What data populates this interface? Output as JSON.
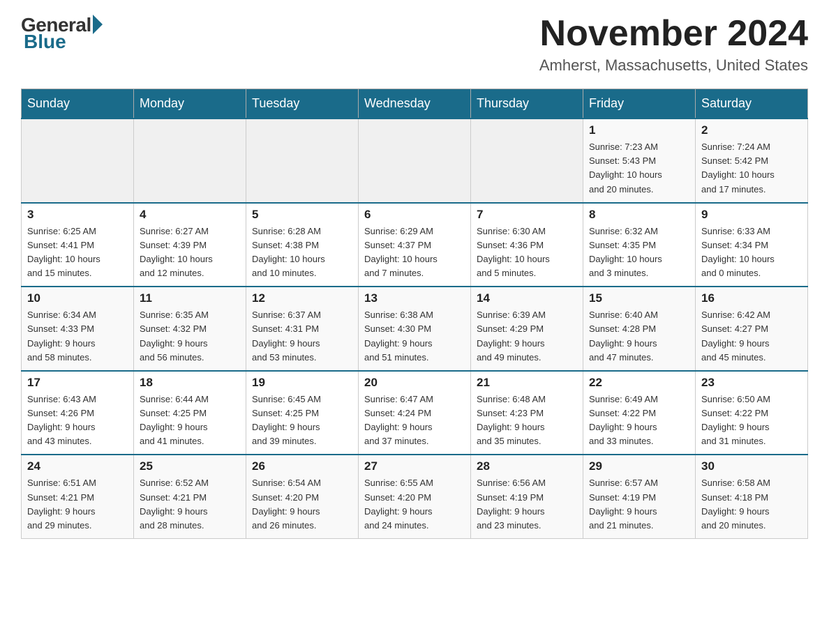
{
  "header": {
    "logo_general": "General",
    "logo_blue": "Blue",
    "month_title": "November 2024",
    "location": "Amherst, Massachusetts, United States"
  },
  "weekdays": [
    "Sunday",
    "Monday",
    "Tuesday",
    "Wednesday",
    "Thursday",
    "Friday",
    "Saturday"
  ],
  "weeks": [
    [
      {
        "day": "",
        "info": ""
      },
      {
        "day": "",
        "info": ""
      },
      {
        "day": "",
        "info": ""
      },
      {
        "day": "",
        "info": ""
      },
      {
        "day": "",
        "info": ""
      },
      {
        "day": "1",
        "info": "Sunrise: 7:23 AM\nSunset: 5:43 PM\nDaylight: 10 hours\nand 20 minutes."
      },
      {
        "day": "2",
        "info": "Sunrise: 7:24 AM\nSunset: 5:42 PM\nDaylight: 10 hours\nand 17 minutes."
      }
    ],
    [
      {
        "day": "3",
        "info": "Sunrise: 6:25 AM\nSunset: 4:41 PM\nDaylight: 10 hours\nand 15 minutes."
      },
      {
        "day": "4",
        "info": "Sunrise: 6:27 AM\nSunset: 4:39 PM\nDaylight: 10 hours\nand 12 minutes."
      },
      {
        "day": "5",
        "info": "Sunrise: 6:28 AM\nSunset: 4:38 PM\nDaylight: 10 hours\nand 10 minutes."
      },
      {
        "day": "6",
        "info": "Sunrise: 6:29 AM\nSunset: 4:37 PM\nDaylight: 10 hours\nand 7 minutes."
      },
      {
        "day": "7",
        "info": "Sunrise: 6:30 AM\nSunset: 4:36 PM\nDaylight: 10 hours\nand 5 minutes."
      },
      {
        "day": "8",
        "info": "Sunrise: 6:32 AM\nSunset: 4:35 PM\nDaylight: 10 hours\nand 3 minutes."
      },
      {
        "day": "9",
        "info": "Sunrise: 6:33 AM\nSunset: 4:34 PM\nDaylight: 10 hours\nand 0 minutes."
      }
    ],
    [
      {
        "day": "10",
        "info": "Sunrise: 6:34 AM\nSunset: 4:33 PM\nDaylight: 9 hours\nand 58 minutes."
      },
      {
        "day": "11",
        "info": "Sunrise: 6:35 AM\nSunset: 4:32 PM\nDaylight: 9 hours\nand 56 minutes."
      },
      {
        "day": "12",
        "info": "Sunrise: 6:37 AM\nSunset: 4:31 PM\nDaylight: 9 hours\nand 53 minutes."
      },
      {
        "day": "13",
        "info": "Sunrise: 6:38 AM\nSunset: 4:30 PM\nDaylight: 9 hours\nand 51 minutes."
      },
      {
        "day": "14",
        "info": "Sunrise: 6:39 AM\nSunset: 4:29 PM\nDaylight: 9 hours\nand 49 minutes."
      },
      {
        "day": "15",
        "info": "Sunrise: 6:40 AM\nSunset: 4:28 PM\nDaylight: 9 hours\nand 47 minutes."
      },
      {
        "day": "16",
        "info": "Sunrise: 6:42 AM\nSunset: 4:27 PM\nDaylight: 9 hours\nand 45 minutes."
      }
    ],
    [
      {
        "day": "17",
        "info": "Sunrise: 6:43 AM\nSunset: 4:26 PM\nDaylight: 9 hours\nand 43 minutes."
      },
      {
        "day": "18",
        "info": "Sunrise: 6:44 AM\nSunset: 4:25 PM\nDaylight: 9 hours\nand 41 minutes."
      },
      {
        "day": "19",
        "info": "Sunrise: 6:45 AM\nSunset: 4:25 PM\nDaylight: 9 hours\nand 39 minutes."
      },
      {
        "day": "20",
        "info": "Sunrise: 6:47 AM\nSunset: 4:24 PM\nDaylight: 9 hours\nand 37 minutes."
      },
      {
        "day": "21",
        "info": "Sunrise: 6:48 AM\nSunset: 4:23 PM\nDaylight: 9 hours\nand 35 minutes."
      },
      {
        "day": "22",
        "info": "Sunrise: 6:49 AM\nSunset: 4:22 PM\nDaylight: 9 hours\nand 33 minutes."
      },
      {
        "day": "23",
        "info": "Sunrise: 6:50 AM\nSunset: 4:22 PM\nDaylight: 9 hours\nand 31 minutes."
      }
    ],
    [
      {
        "day": "24",
        "info": "Sunrise: 6:51 AM\nSunset: 4:21 PM\nDaylight: 9 hours\nand 29 minutes."
      },
      {
        "day": "25",
        "info": "Sunrise: 6:52 AM\nSunset: 4:21 PM\nDaylight: 9 hours\nand 28 minutes."
      },
      {
        "day": "26",
        "info": "Sunrise: 6:54 AM\nSunset: 4:20 PM\nDaylight: 9 hours\nand 26 minutes."
      },
      {
        "day": "27",
        "info": "Sunrise: 6:55 AM\nSunset: 4:20 PM\nDaylight: 9 hours\nand 24 minutes."
      },
      {
        "day": "28",
        "info": "Sunrise: 6:56 AM\nSunset: 4:19 PM\nDaylight: 9 hours\nand 23 minutes."
      },
      {
        "day": "29",
        "info": "Sunrise: 6:57 AM\nSunset: 4:19 PM\nDaylight: 9 hours\nand 21 minutes."
      },
      {
        "day": "30",
        "info": "Sunrise: 6:58 AM\nSunset: 4:18 PM\nDaylight: 9 hours\nand 20 minutes."
      }
    ]
  ]
}
